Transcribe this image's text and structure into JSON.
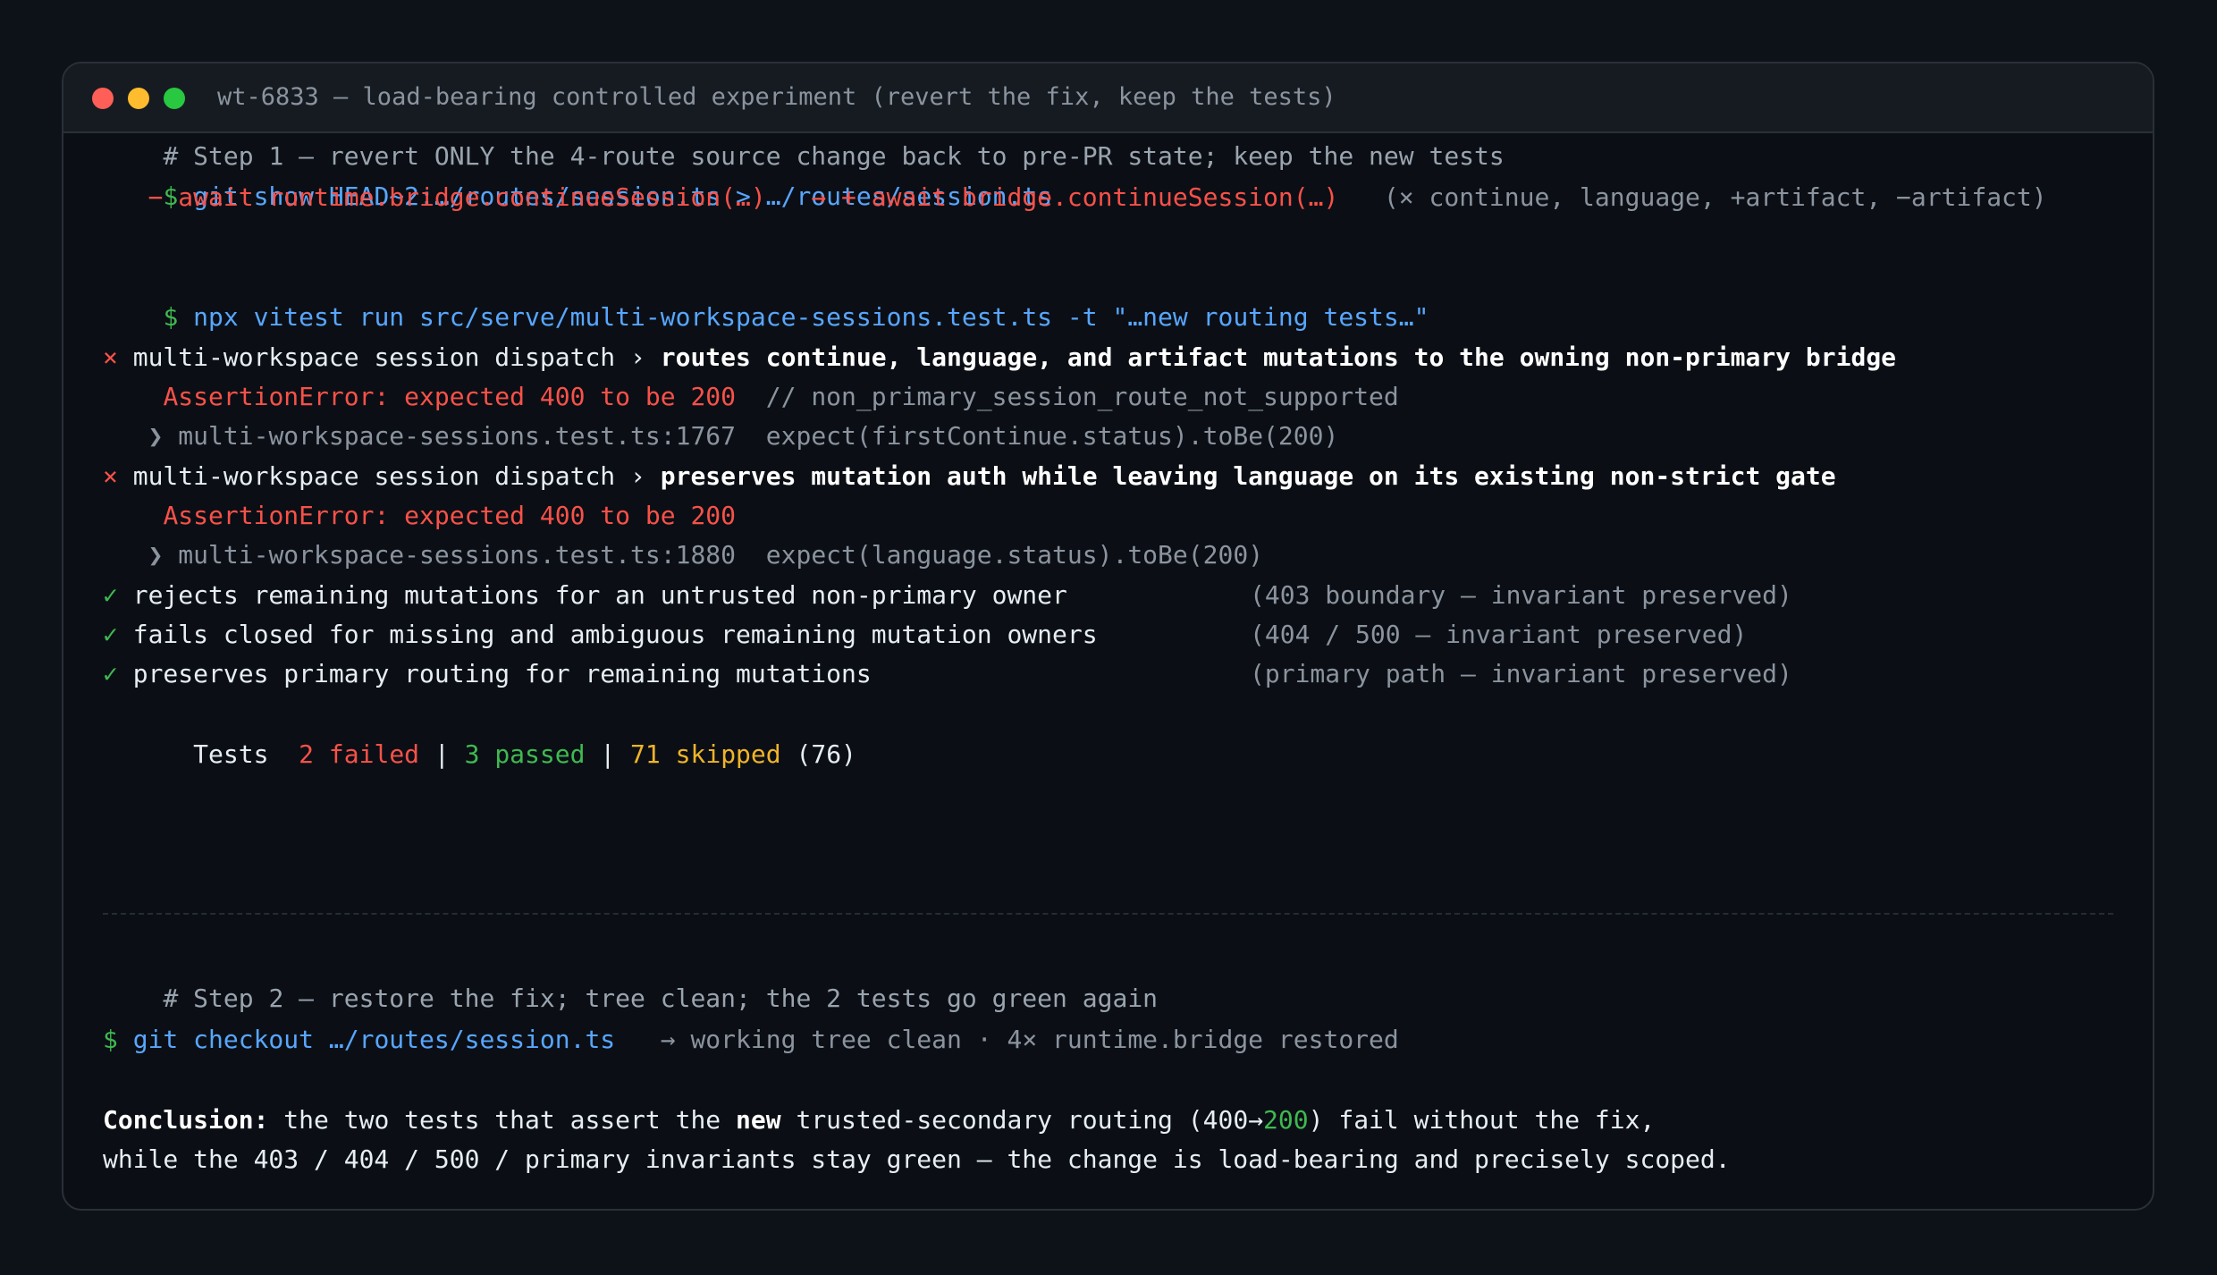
{
  "window": {
    "title": "wt-6833 — load-bearing controlled experiment (revert the fix, keep the tests)"
  },
  "step1": {
    "comment": "# Step 1 — revert ONLY the 4-route source change back to pre-PR state; keep the new tests",
    "prompt": "$",
    "git_cmd": "git show HEAD~2:…/routes/session.ts > …/routes/session.ts",
    "diff_minus": "− await runtime.bridge.continueSession(…)",
    "diff_arrow": "→ + await bridge.continueSession(…)",
    "diff_note": "(× continue, language, +artifact, −artifact)",
    "vitest_cmd": "npx vitest run src/serve/multi-workspace-sessions.test.ts -t \"…new routing tests…\""
  },
  "results": {
    "fail1": {
      "mark": "×",
      "suite": "multi-workspace session dispatch ›",
      "test": "routes continue, language, and artifact mutations to the owning non-primary bridge",
      "error": "AssertionError: expected 400 to be 200",
      "error_comment": "// non_primary_session_route_not_supported",
      "trace_arrow": "❯",
      "trace_loc": "multi-workspace-sessions.test.ts:1767",
      "trace_code": "expect(firstContinue.status).toBe(200)"
    },
    "fail2": {
      "mark": "×",
      "suite": "multi-workspace session dispatch ›",
      "test": "preserves mutation auth while leaving language on its existing non-strict gate",
      "error": "AssertionError: expected 400 to be 200",
      "trace_arrow": "❯",
      "trace_loc": "multi-workspace-sessions.test.ts:1880",
      "trace_code": "expect(language.status).toBe(200)"
    },
    "passes": [
      {
        "mark": "✓",
        "text": "rejects remaining mutations for an untrusted non-primary owner",
        "note": "(403 boundary — invariant preserved)"
      },
      {
        "mark": "✓",
        "text": "fails closed for missing and ambiguous remaining mutation owners",
        "note": "(404 / 500 — invariant preserved)"
      },
      {
        "mark": "✓",
        "text": "preserves primary routing for remaining mutations",
        "note": "(primary path — invariant preserved)"
      }
    ],
    "summary": {
      "label": "Tests",
      "failed": "2 failed",
      "sep": "|",
      "passed": "3 passed",
      "skipped": "71 skipped",
      "total": "(76)"
    }
  },
  "step2": {
    "comment": "# Step 2 — restore the fix; tree clean; the 2 tests go green again",
    "prompt": "$",
    "git_cmd": "git checkout …/routes/session.ts",
    "result": "→ working tree clean · 4× runtime.bridge restored"
  },
  "conclusion": {
    "label": "Conclusion:",
    "part1": " the two tests that assert the ",
    "emph": "new",
    "part2": " trusted-secondary routing (400→",
    "code_ok": "200",
    "part3": ") fail without the fix,",
    "line2": "while the 403 / 404 / 500 / primary invariants stay green — the change is load-bearing and precisely scoped."
  },
  "colors": {
    "background": "#0d1118",
    "terminal": "#0b0f15",
    "red": "#f85149",
    "green": "#3fb950",
    "blue": "#58a6ff",
    "yellow": "#f0b429",
    "muted": "#8b949e"
  }
}
